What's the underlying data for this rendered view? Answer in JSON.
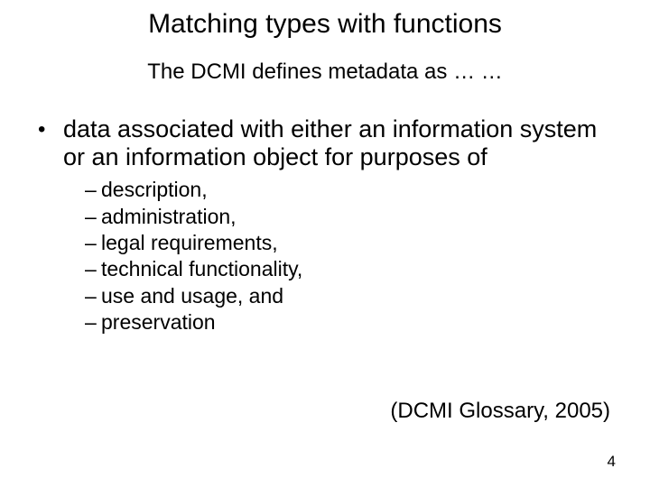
{
  "title": "Matching types with functions",
  "subtitle": "The DCMI defines metadata as … …",
  "main_bullet": "data associated with either an information system or an information object for purposes of",
  "sub_bullets": [
    "description,",
    "administration,",
    "legal requirements,",
    "technical functionality,",
    "use and usage, and",
    "preservation"
  ],
  "citation": "(DCMI Glossary, 2005)",
  "page_number": "4"
}
